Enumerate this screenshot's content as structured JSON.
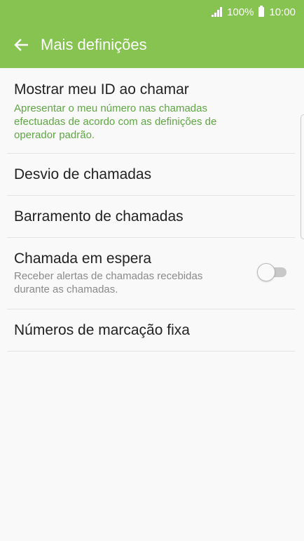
{
  "status_bar": {
    "battery_percent": "100%",
    "time": "10:00",
    "icons": [
      "signal-icon",
      "battery-icon"
    ]
  },
  "toolbar": {
    "title": "Mais definições",
    "back_icon": "arrow-left-icon"
  },
  "settings": [
    {
      "title": "Mostrar meu ID ao chamar",
      "subtitle": "Apresentar o meu número nas chamadas efectuadas de acordo com as definições de operador padrão."
    },
    {
      "title": "Desvio de chamadas"
    },
    {
      "title": "Barramento de chamadas"
    },
    {
      "title": "Chamada em espera",
      "subtitle": "Receber alertas de chamadas recebidas durante as chamadas.",
      "toggle_on": false
    },
    {
      "title": "Números de marcação fixa"
    }
  ],
  "colors": {
    "header": "#86c350",
    "accent_text": "#5fa644",
    "background": "#f9f9f9"
  }
}
